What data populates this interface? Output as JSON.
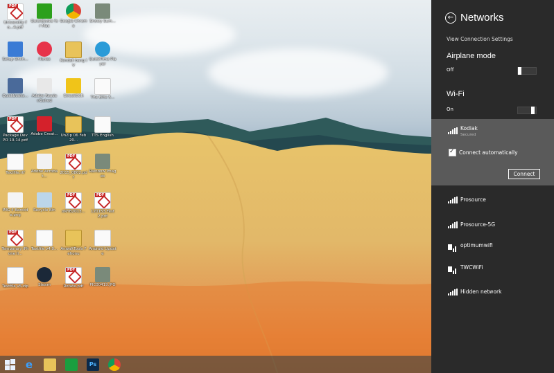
{
  "desktop": {
    "icons": [
      {
        "label": "Universitiy fo...4.pdf",
        "icon": "pdf-icon"
      },
      {
        "label": "QuickBooks for Mac",
        "icon": "quickbooks-icon"
      },
      {
        "label": "Google Chrome",
        "icon": "chrome-icon"
      },
      {
        "label": "Snowy Sum...",
        "icon": "image-icon"
      },
      {
        "label": "Setup Onlin...",
        "icon": "setup-icon"
      },
      {
        "label": "iTunes",
        "icon": "itunes-icon"
      },
      {
        "label": "Kendali bang IV",
        "icon": "folder-icon"
      },
      {
        "label": "QuickTime Player",
        "icon": "quicktime-icon"
      },
      {
        "label": "Quickbooks...",
        "icon": "quickbooks-doc-icon"
      },
      {
        "label": "Adobe Reader/Gshed",
        "icon": "adobe-reader-icon"
      },
      {
        "label": "StreetOCR",
        "icon": "streetocr-icon"
      },
      {
        "label": "The Elite 5...",
        "icon": "document-icon"
      },
      {
        "label": "Package Dev PO 10-14.pdf",
        "icon": "pdf-icon"
      },
      {
        "label": "Adobe Creat...",
        "icon": "adobe-cc-icon"
      },
      {
        "label": "UnZip 06 Feb 20...",
        "icon": "folder-icon"
      },
      {
        "label": "TTS English",
        "icon": "document-icon"
      },
      {
        "label": "Textfile.rtf",
        "icon": "document-icon"
      },
      {
        "label": "Adobe Acrobat...",
        "icon": "acrobat-icon"
      },
      {
        "label": "2015_0802.pdf",
        "icon": "pdf-icon"
      },
      {
        "label": "Rainbow Images",
        "icon": "image-icon"
      },
      {
        "label": "IMG 4 Barcode.png",
        "icon": "barcode-icon"
      },
      {
        "label": "Recycle Bin",
        "icon": "recycle-bin-icon"
      },
      {
        "label": "oNYB2013...",
        "icon": "pdf-icon"
      },
      {
        "label": "120153 Fest 2.pdf",
        "icon": "pdf-icon"
      },
      {
        "label": "Temporary iPhone li...",
        "icon": "pdf-icon"
      },
      {
        "label": "Textfile v4.0...",
        "icon": "document-icon"
      },
      {
        "label": "AnwaltTools Fehonu",
        "icon": "folder-icon"
      },
      {
        "label": "Android Update",
        "icon": "document-icon"
      },
      {
        "label": "Textfile v5.zip",
        "icon": "document-icon"
      },
      {
        "label": "Steam",
        "icon": "steam-icon"
      },
      {
        "label": "Rotate.pdf",
        "icon": "pdf-icon"
      },
      {
        "label": "PIC00419.JPG",
        "icon": "image-icon"
      }
    ]
  },
  "panel": {
    "title": "Networks",
    "view_settings": "View Connection Settings",
    "airplane": {
      "label": "Airplane mode",
      "state": "Off",
      "on": false
    },
    "wifi": {
      "label": "Wi-Fi",
      "state": "On",
      "on": true
    },
    "selected": {
      "name": "Kodiak",
      "status": "Secured",
      "auto_label": "Connect automatically",
      "button": "Connect"
    },
    "networks": [
      {
        "name": "Prosource",
        "secured": false
      },
      {
        "name": "Prosource-5G",
        "secured": false
      },
      {
        "name": "optimumwifi",
        "secured": true
      },
      {
        "name": "TWCWiFi",
        "secured": true
      },
      {
        "name": "Hidden network",
        "secured": false
      }
    ]
  },
  "colors": {
    "panel_bg": "#2a2a2a",
    "selected_bg": "#5a5a5a",
    "accent": "#ffffff"
  }
}
